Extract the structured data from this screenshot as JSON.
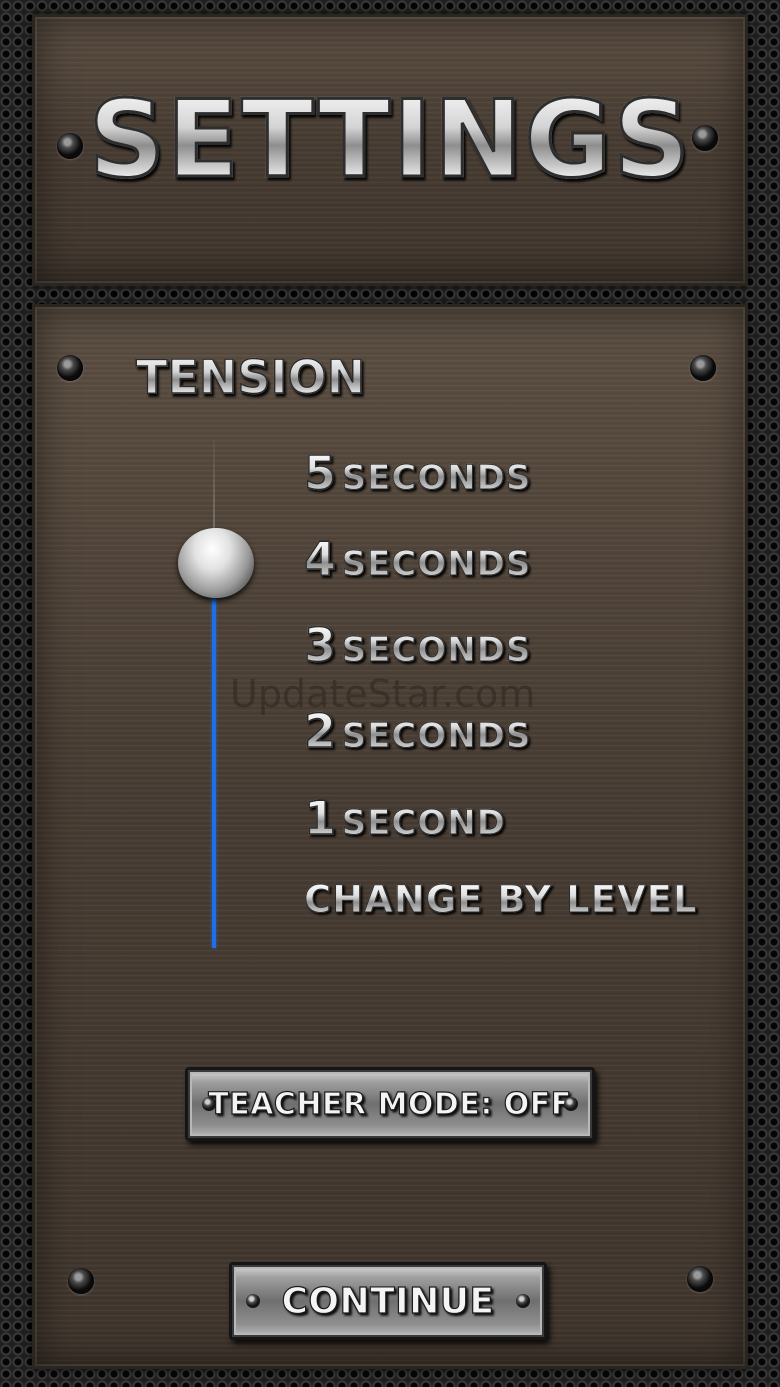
{
  "header": {
    "title": "SETTINGS"
  },
  "tension": {
    "label": "TENSION",
    "options": [
      {
        "number": "5",
        "unit": "SECONDS"
      },
      {
        "number": "4",
        "unit": "SECONDS"
      },
      {
        "number": "3",
        "unit": "SECONDS"
      },
      {
        "number": "2",
        "unit": "SECONDS"
      },
      {
        "number": "1",
        "unit": "SECOND"
      }
    ],
    "change_by_level": "CHANGE BY LEVEL",
    "selected": "4 SECONDS",
    "track_color": "#1f6fe6"
  },
  "watermark": "UpdateStar.com",
  "buttons": {
    "teacher_mode": "TEACHER MODE: OFF",
    "continue": "CONTINUE"
  }
}
